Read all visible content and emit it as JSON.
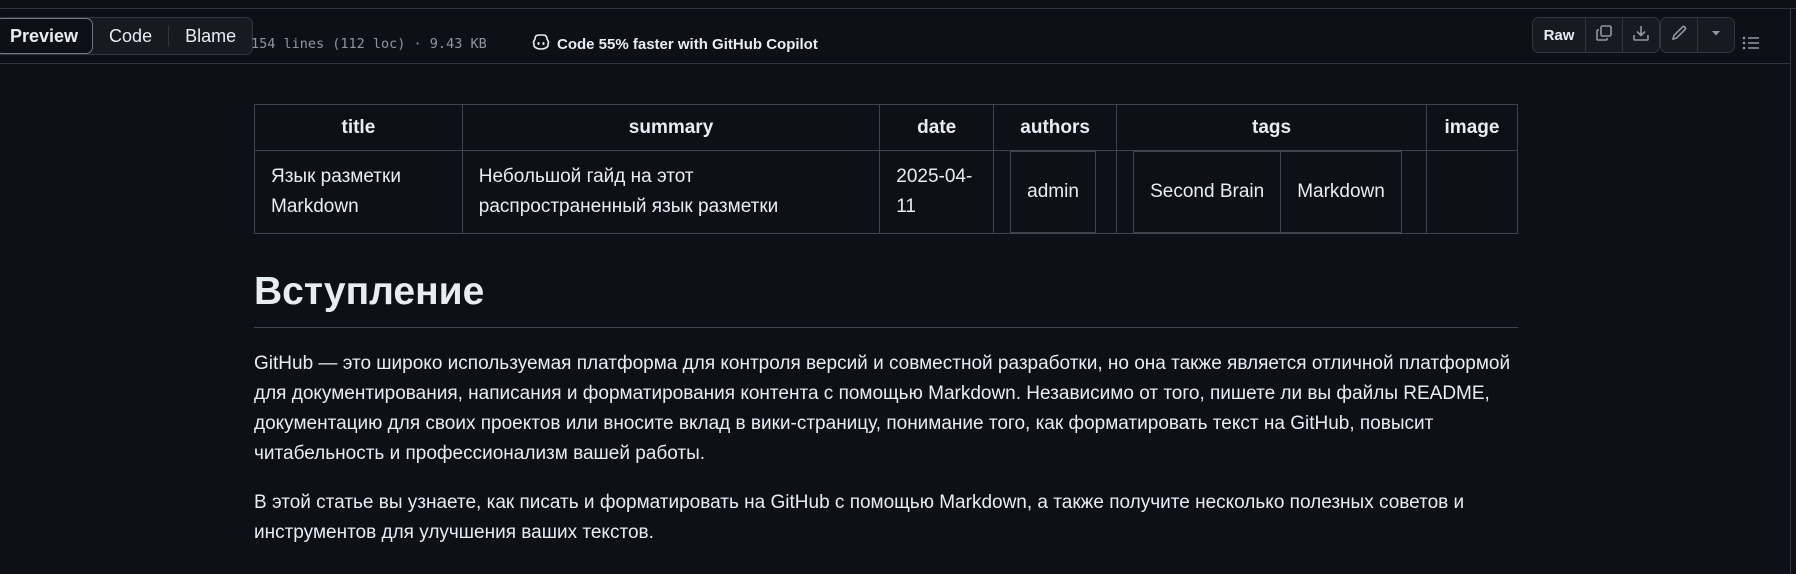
{
  "toolbar": {
    "tabs": [
      {
        "label": "Preview",
        "active": true
      },
      {
        "label": "Code",
        "active": false
      },
      {
        "label": "Blame",
        "active": false
      }
    ],
    "file_meta": "154 lines (112 loc) · 9.43 KB",
    "copilot_text": "Code 55% faster with GitHub Copilot",
    "raw_label": "Raw",
    "icons": [
      "copy-icon",
      "download-icon",
      "pencil-icon",
      "triangle-down-icon",
      "list-unordered-icon",
      "copilot-icon"
    ]
  },
  "frontmatter": {
    "headers": [
      "title",
      "summary",
      "date",
      "authors",
      "tags",
      "image"
    ],
    "title": "Язык разметки Markdown",
    "summary": "Небольшой гайд на этот распространенный язык разметки",
    "date": "2025-04-11",
    "authors": [
      "admin"
    ],
    "tags": [
      "Second Brain",
      "Markdown"
    ],
    "image": ""
  },
  "article": {
    "heading": "Вступление",
    "paragraphs": [
      "GitHub — это широко используемая платформа для контроля версий и совместной разработки, но она также является отличной платформой для документирования, написания и форматирования контента с помощью Markdown. Независимо от того, пишете ли вы файлы README, документацию для своих проектов или вносите вклад в вики-страницу, понимание того, как форматировать текст на GitHub, повысит читабельность и профессионализм вашей работы.",
      "В этой статье вы узнаете, как писать и форматировать на GitHub с помощью Markdown, а также получите несколько полезных советов и инструментов для улучшения ваших текстов."
    ]
  },
  "colors": {
    "background": "#0d1117",
    "border": "#30363d",
    "text": "#e6edf3",
    "muted": "#8d96a0"
  }
}
